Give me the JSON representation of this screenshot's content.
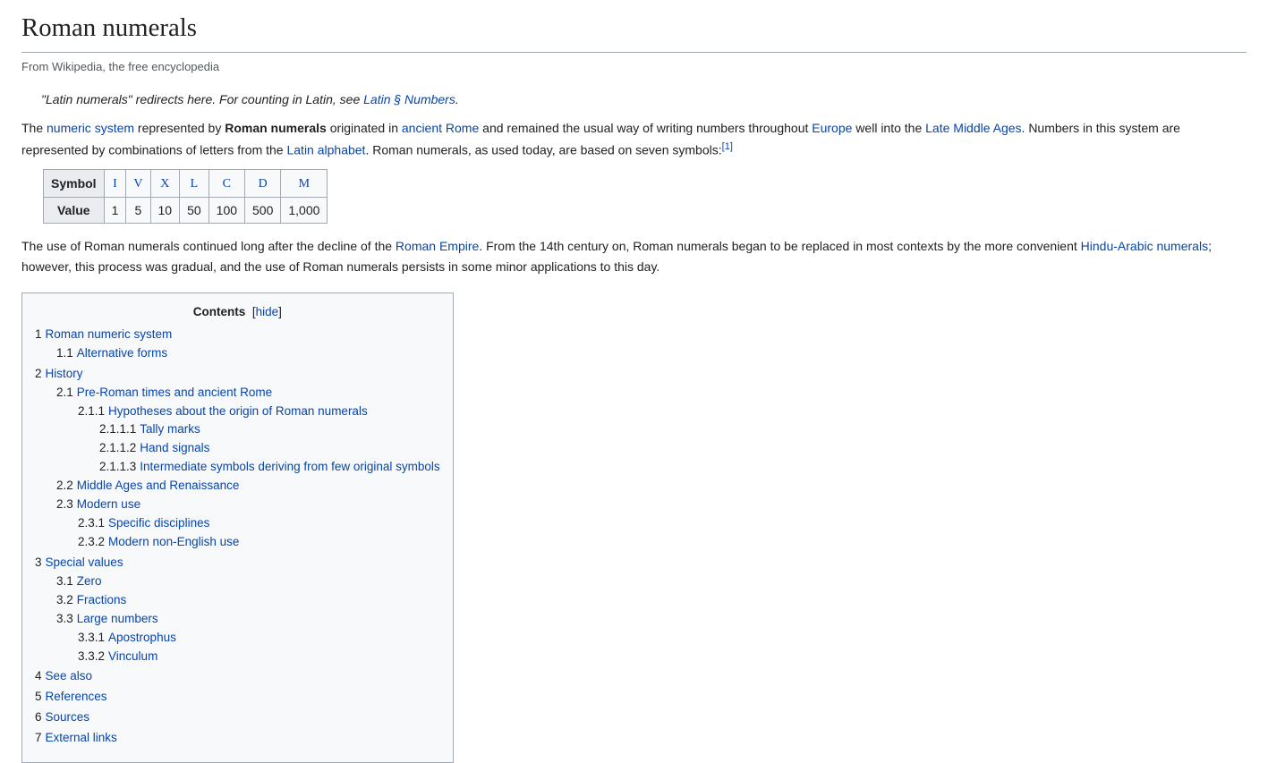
{
  "title": "Roman numerals",
  "subtitle": "From Wikipedia, the free encyclopedia",
  "hatnote": {
    "prefix": "\"Latin numerals\" redirects here. For counting in Latin, see ",
    "link": "Latin § Numbers",
    "suffix": "."
  },
  "para1": {
    "t0": "The ",
    "l0": "numeric system",
    "t1": " represented by ",
    "b1": "Roman numerals",
    "t2": " originated in ",
    "l2": "ancient Rome",
    "t3": " and remained the usual way of writing numbers throughout ",
    "l3": "Europe",
    "t4": " well into the ",
    "l4": "Late Middle Ages",
    "t5": ". Numbers in this system are represented by combinations of letters from the ",
    "l5": "Latin alphabet",
    "t6": ". Roman numerals, as used today, are based on seven symbols:",
    "ref": "[1]"
  },
  "table": {
    "row_labels": [
      "Symbol",
      "Value"
    ],
    "symbols": [
      "I",
      "V",
      "X",
      "L",
      "C",
      "D",
      "M"
    ],
    "values": [
      "1",
      "5",
      "10",
      "50",
      "100",
      "500",
      "1,000"
    ]
  },
  "para2": {
    "t0": "The use of Roman numerals continued long after the decline of the ",
    "l0": "Roman Empire",
    "t1": ". From the 14th century on, Roman numerals began to be replaced in most contexts by the more convenient ",
    "l1": "Hindu-Arabic numerals",
    "t2": "; however, this process was gradual, and the use of Roman numerals persists in some minor applications to this day."
  },
  "toc": {
    "title": "Contents",
    "hide": "hide",
    "items": [
      {
        "n": "1",
        "t": "Roman numeric system",
        "c": [
          {
            "n": "1.1",
            "t": "Alternative forms"
          }
        ]
      },
      {
        "n": "2",
        "t": "History",
        "c": [
          {
            "n": "2.1",
            "t": "Pre-Roman times and ancient Rome",
            "c": [
              {
                "n": "2.1.1",
                "t": "Hypotheses about the origin of Roman numerals",
                "c": [
                  {
                    "n": "2.1.1.1",
                    "t": "Tally marks"
                  },
                  {
                    "n": "2.1.1.2",
                    "t": "Hand signals"
                  },
                  {
                    "n": "2.1.1.3",
                    "t": "Intermediate symbols deriving from few original symbols"
                  }
                ]
              }
            ]
          },
          {
            "n": "2.2",
            "t": "Middle Ages and Renaissance"
          },
          {
            "n": "2.3",
            "t": "Modern use",
            "c": [
              {
                "n": "2.3.1",
                "t": "Specific disciplines"
              },
              {
                "n": "2.3.2",
                "t": "Modern non-English use"
              }
            ]
          }
        ]
      },
      {
        "n": "3",
        "t": "Special values",
        "c": [
          {
            "n": "3.1",
            "t": "Zero"
          },
          {
            "n": "3.2",
            "t": "Fractions"
          },
          {
            "n": "3.3",
            "t": "Large numbers",
            "c": [
              {
                "n": "3.3.1",
                "t": "Apostrophus"
              },
              {
                "n": "3.3.2",
                "t": "Vinculum"
              }
            ]
          }
        ]
      },
      {
        "n": "4",
        "t": "See also"
      },
      {
        "n": "5",
        "t": "References"
      },
      {
        "n": "6",
        "t": "Sources"
      },
      {
        "n": "7",
        "t": "External links"
      }
    ]
  }
}
